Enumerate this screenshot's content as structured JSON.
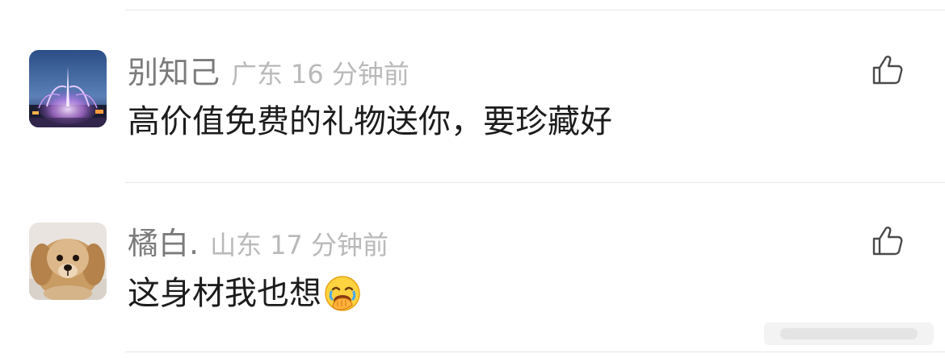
{
  "comments": [
    {
      "username": "别知己",
      "location": "广东",
      "time": "16 分钟前",
      "content": "高价值免费的礼物送你，要珍藏好",
      "avatar_icon": "fountain-photo-avatar",
      "like_icon": "thumbs-up-icon"
    },
    {
      "username": "橘白.",
      "location": "山东",
      "time": "17 分钟前",
      "content": "这身材我也想",
      "content_emoji": "face-with-hand-over-mouth-laughing-emoji",
      "avatar_icon": "puppy-photo-avatar",
      "like_icon": "thumbs-up-icon"
    }
  ],
  "colors": {
    "username": "#7b7b7b",
    "meta": "#b9b9b9",
    "content": "#1c1c1c",
    "divider": "#e6e6e6"
  }
}
